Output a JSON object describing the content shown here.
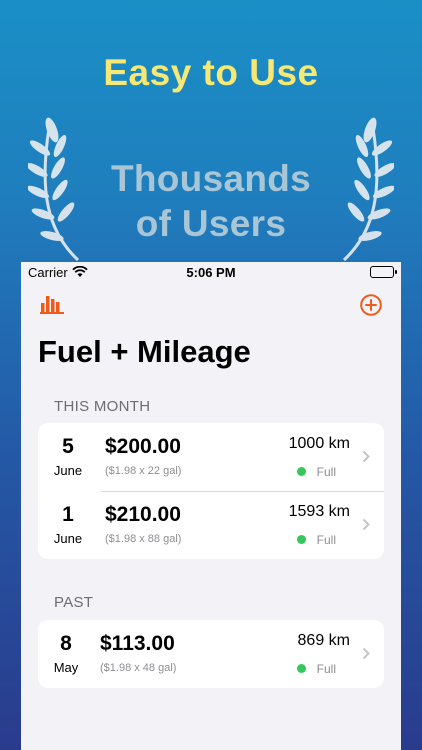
{
  "promo": {
    "headline": "Easy to Use",
    "award_line1": "Thousands",
    "award_line2": "of Users",
    "headline_color": "#f6e873"
  },
  "status_bar": {
    "carrier": "Carrier",
    "time": "5:06 PM"
  },
  "nav": {
    "left_icon": "bar-chart-icon",
    "right_icon": "plus-circle-icon",
    "accent_color": "#f05a1a"
  },
  "title": "Fuel + Mileage",
  "sections": [
    {
      "label": "THIS MONTH",
      "entries": [
        {
          "day": "5",
          "month": "June",
          "amount": "$200.00",
          "detail": "($1.98 x 22 gal)",
          "distance": "1000 km",
          "status": "Full",
          "status_color": "#34c759"
        },
        {
          "day": "1",
          "month": "June",
          "amount": "$210.00",
          "detail": "($1.98 x 88 gal)",
          "distance": "1593 km",
          "status": "Full",
          "status_color": "#34c759"
        }
      ]
    },
    {
      "label": "PAST",
      "entries": [
        {
          "day": "8",
          "month": "May",
          "amount": "$113.00",
          "detail": "($1.98 x 48 gal)",
          "distance": "869 km",
          "status": "Full",
          "status_color": "#34c759"
        }
      ]
    }
  ]
}
